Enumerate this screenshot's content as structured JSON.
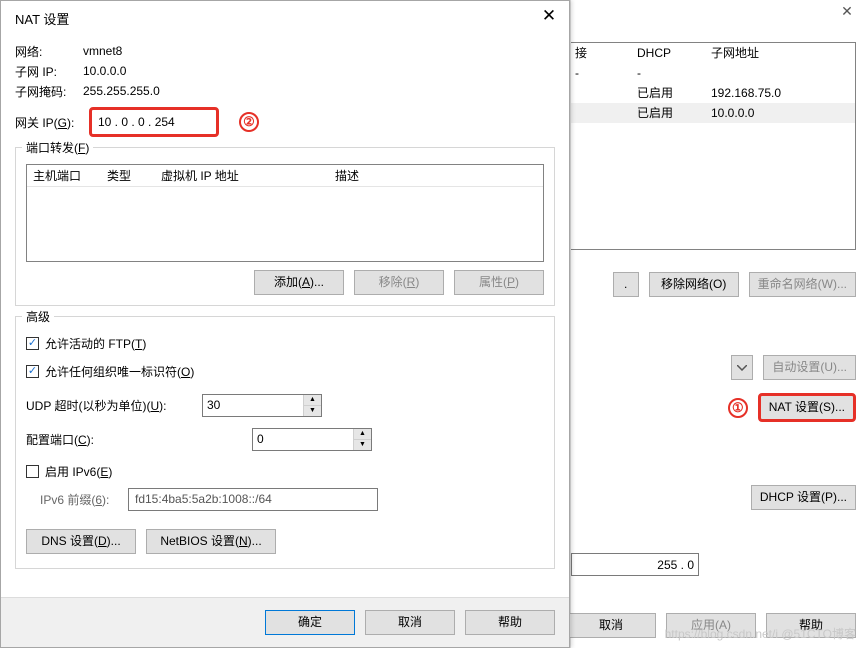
{
  "dialog": {
    "title": "NAT 设置",
    "network_lbl": "网络:",
    "network_val": "vmnet8",
    "subnet_ip_lbl": "子网 IP:",
    "subnet_ip_val": "10.0.0.0",
    "subnet_mask_lbl": "子网掩码:",
    "subnet_mask_val": "255.255.255.0",
    "gateway_lbl": "网关 IP(G):",
    "gateway_val": "10  .  0   .  0   . 254",
    "annotation2": "②",
    "port_fwd": {
      "legend": "端口转发(F)",
      "cols": {
        "host": "主机端口",
        "type": "类型",
        "vmip": "虚拟机 IP 地址",
        "desc": "描述"
      },
      "add": "添加(A)...",
      "remove": "移除(R)",
      "props": "属性(P)"
    },
    "advanced": {
      "legend": "高级",
      "ftp": "允许活动的 FTP(T)",
      "oui": "允许任何组织唯一标识符(O)",
      "udp_lbl": "UDP 超时(以秒为单位)(U):",
      "udp_val": "30",
      "cfgport_lbl": "配置端口(C):",
      "cfgport_val": "0",
      "ipv6": "启用 IPv6(E)",
      "ipv6prefix_lbl": "IPv6 前缀(6):",
      "ipv6prefix_val": "fd15:4ba5:5a2b:1008::/64",
      "dns": "DNS 设置(D)...",
      "netbios": "NetBIOS 设置(N)..."
    },
    "footer": {
      "ok": "确定",
      "cancel": "取消",
      "help": "帮助"
    }
  },
  "bg": {
    "cols": {
      "conn": "接",
      "dhcp": "DHCP",
      "subaddr": "子网地址"
    },
    "rows": [
      {
        "conn": "-",
        "dhcp": "-",
        "subaddr": ""
      },
      {
        "conn": "",
        "dhcp": "已启用",
        "subaddr": "192.168.75.0"
      },
      {
        "conn": "",
        "dhcp": "已启用",
        "subaddr": "10.0.0.0"
      }
    ],
    "remove_net": "移除网络(O)",
    "rename_net": "重命名网络(W)...",
    "auto_settings": "自动设置(U)...",
    "nat_settings": "NAT 设置(S)...",
    "annotation1": "①",
    "dhcp_settings": "DHCP 设置(P)...",
    "ip_tail": "255 . 0",
    "cancel": "取消",
    "apply": "应用(A)",
    "help": "帮助",
    "watermark": "https://blog.csdn.net/i @51CTO博客"
  }
}
